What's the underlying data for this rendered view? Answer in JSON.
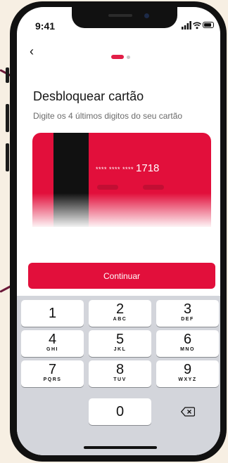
{
  "status_bar": {
    "time": "9:41",
    "icons": [
      "signal-icon",
      "wifi-icon",
      "battery-icon"
    ]
  },
  "nav": {
    "back_label": "‹",
    "progress": {
      "current_step": 1,
      "total_steps": 2
    }
  },
  "page": {
    "title": "Desbloquear cartão",
    "subtitle": "Digite os 4 últimos digitos do seu cartão"
  },
  "card": {
    "masked_number": "**** **** ****",
    "last_digits": "1718",
    "color": "#e20f3b"
  },
  "continue_button": {
    "label": "Continuar",
    "color": "#e20f3b"
  },
  "keypad": {
    "keys": [
      {
        "digit": "1",
        "letters": ""
      },
      {
        "digit": "2",
        "letters": "ABC"
      },
      {
        "digit": "3",
        "letters": "DEF"
      },
      {
        "digit": "4",
        "letters": "GHI"
      },
      {
        "digit": "5",
        "letters": "JKL"
      },
      {
        "digit": "6",
        "letters": "MNO"
      },
      {
        "digit": "7",
        "letters": "PQRS"
      },
      {
        "digit": "8",
        "letters": "TUV"
      },
      {
        "digit": "9",
        "letters": "WXYZ"
      },
      {
        "digit": "0",
        "letters": ""
      }
    ],
    "delete_icon": "backspace-icon"
  }
}
